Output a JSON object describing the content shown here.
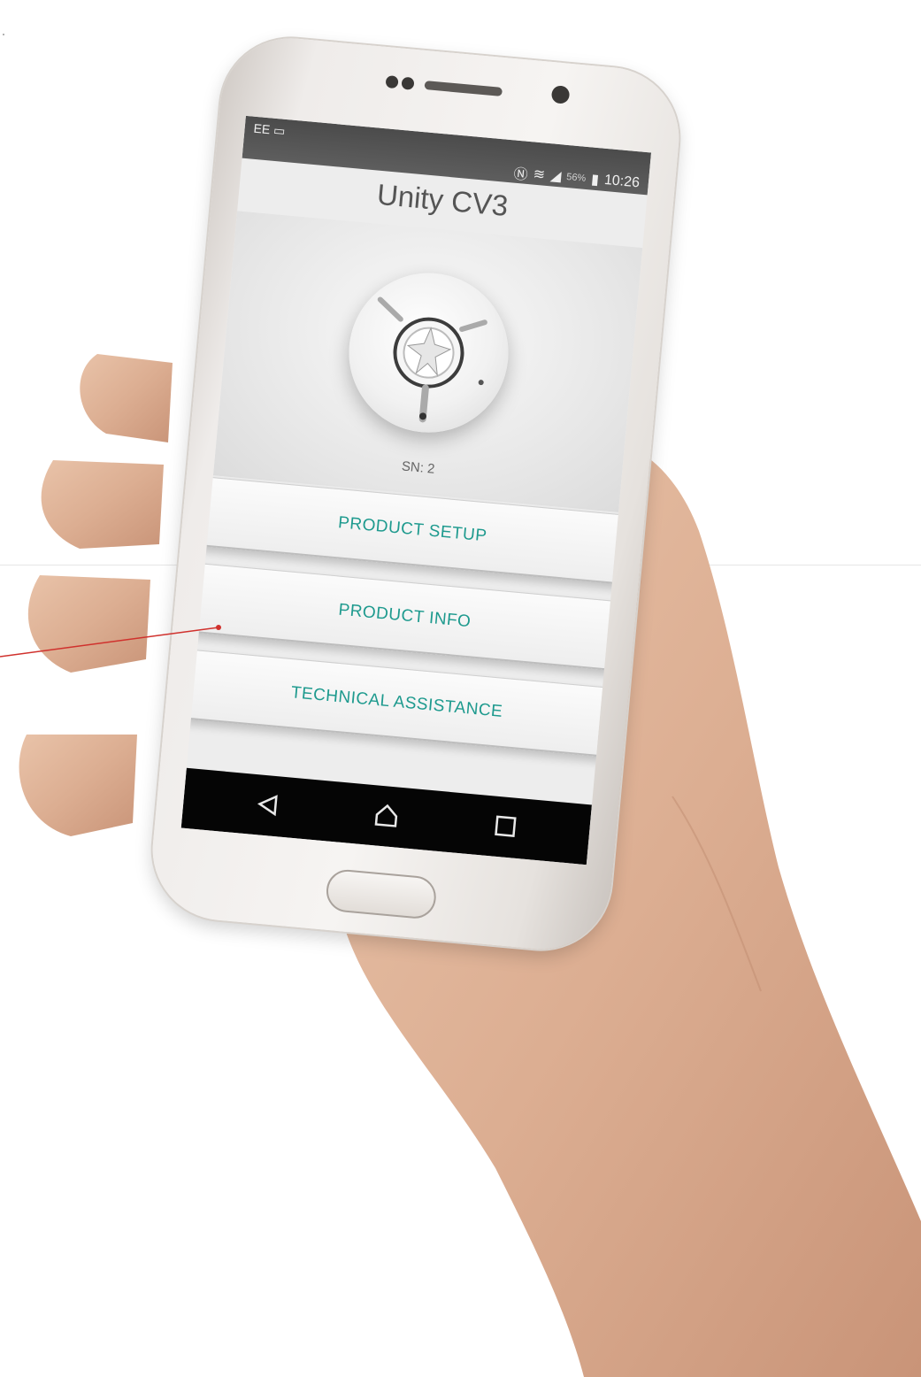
{
  "status_bar": {
    "carrier": "EE",
    "battery": "56%",
    "time": "10:26"
  },
  "app": {
    "title": "Unity CV3",
    "serial": "SN: 2"
  },
  "menu": {
    "product_setup": "PRODUCT SETUP",
    "product_info": "PRODUCT INFO",
    "technical_assistance": "TECHNICAL ASSISTANCE"
  },
  "colors": {
    "accent": "#1e9a8e",
    "annotation": "#d0312d"
  },
  "icons": {
    "nav_back": "back-icon",
    "nav_home": "home-icon",
    "nav_recents": "recents-icon"
  }
}
